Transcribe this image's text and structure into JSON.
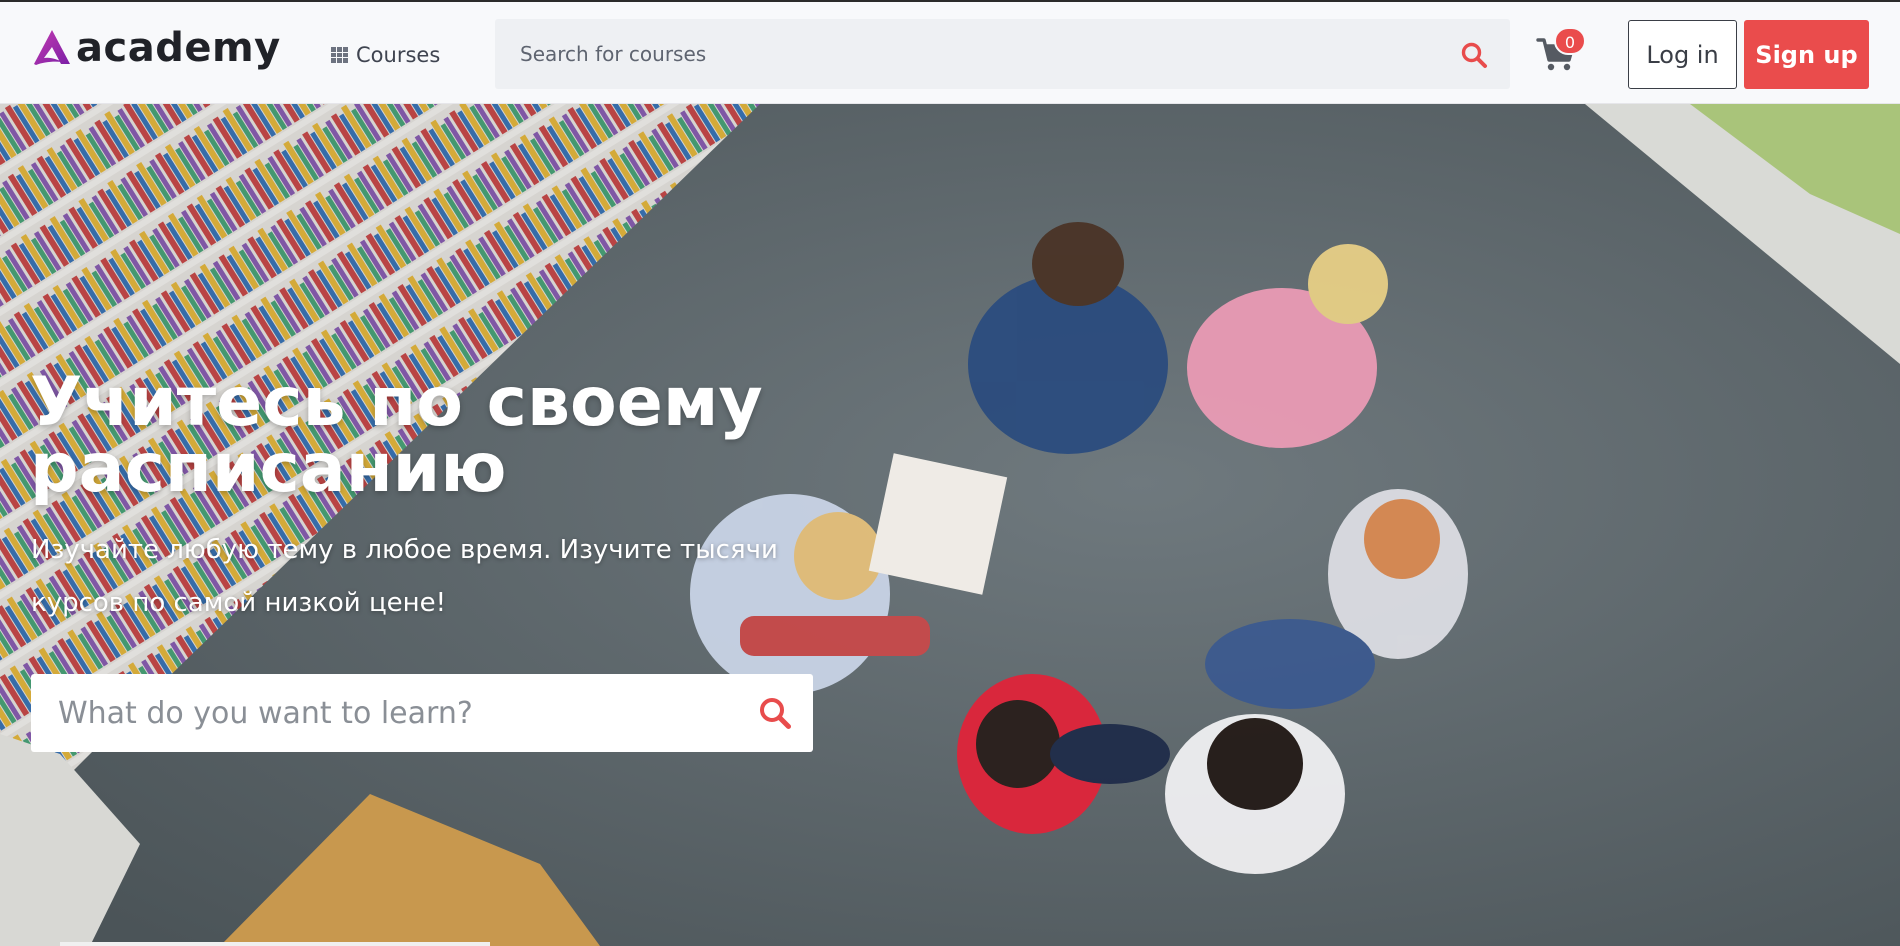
{
  "brand": {
    "name": "academy",
    "accent": "#ea4c4c"
  },
  "nav": {
    "courses_label": "Courses",
    "search_placeholder": "Search for courses",
    "cart_count": "0",
    "login_label": "Log in",
    "signup_label": "Sign up"
  },
  "hero": {
    "title": "Учитесь по своему расписанию",
    "subtitle": "Изучайте любую тему в любое время. Изучите тысячи курсов по самой низкой цене!",
    "search_placeholder": "What do you want to learn?"
  },
  "icons": {
    "courses": "grid-icon",
    "search": "search-icon",
    "cart": "cart-icon",
    "logo": "academy-logo-icon"
  }
}
